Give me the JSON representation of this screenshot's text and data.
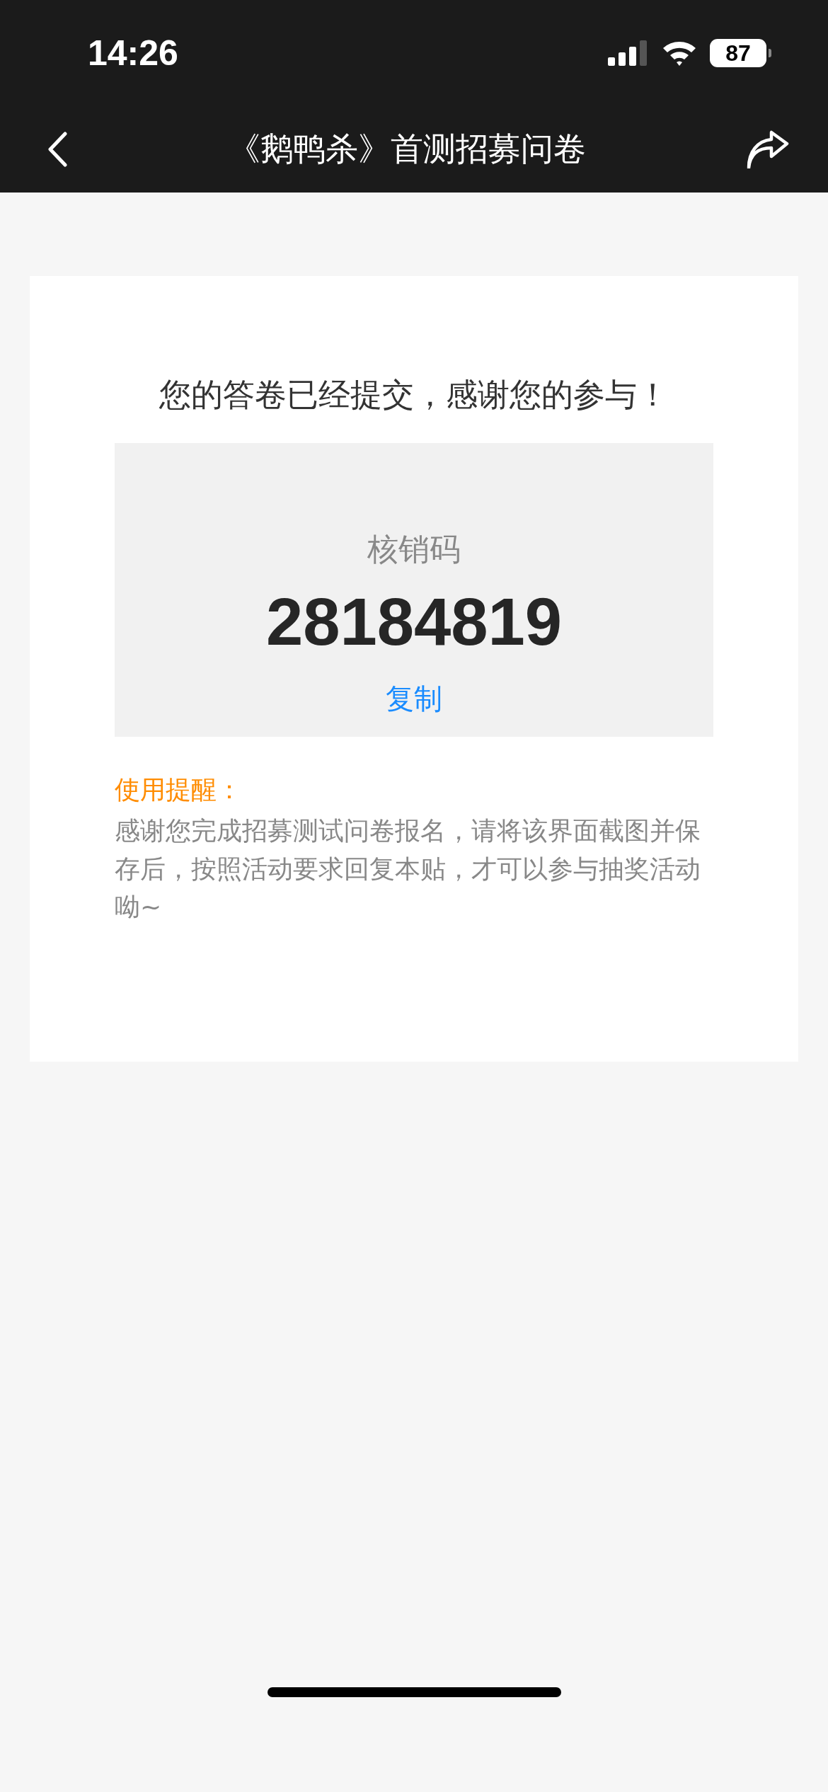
{
  "status_bar": {
    "time": "14:26",
    "battery": "87"
  },
  "nav_bar": {
    "title": "《鹅鸭杀》首测招募问卷"
  },
  "result": {
    "message": "您的答卷已经提交，感谢您的参与！",
    "code_label": "核销码",
    "code": "28184819",
    "copy_button": "复制",
    "tip_title": "使用提醒：",
    "tip_text": "感谢您完成招募测试问卷报名，请将该界面截图并保存后，按照活动要求回复本贴，才可以参与抽奖活动呦~"
  }
}
